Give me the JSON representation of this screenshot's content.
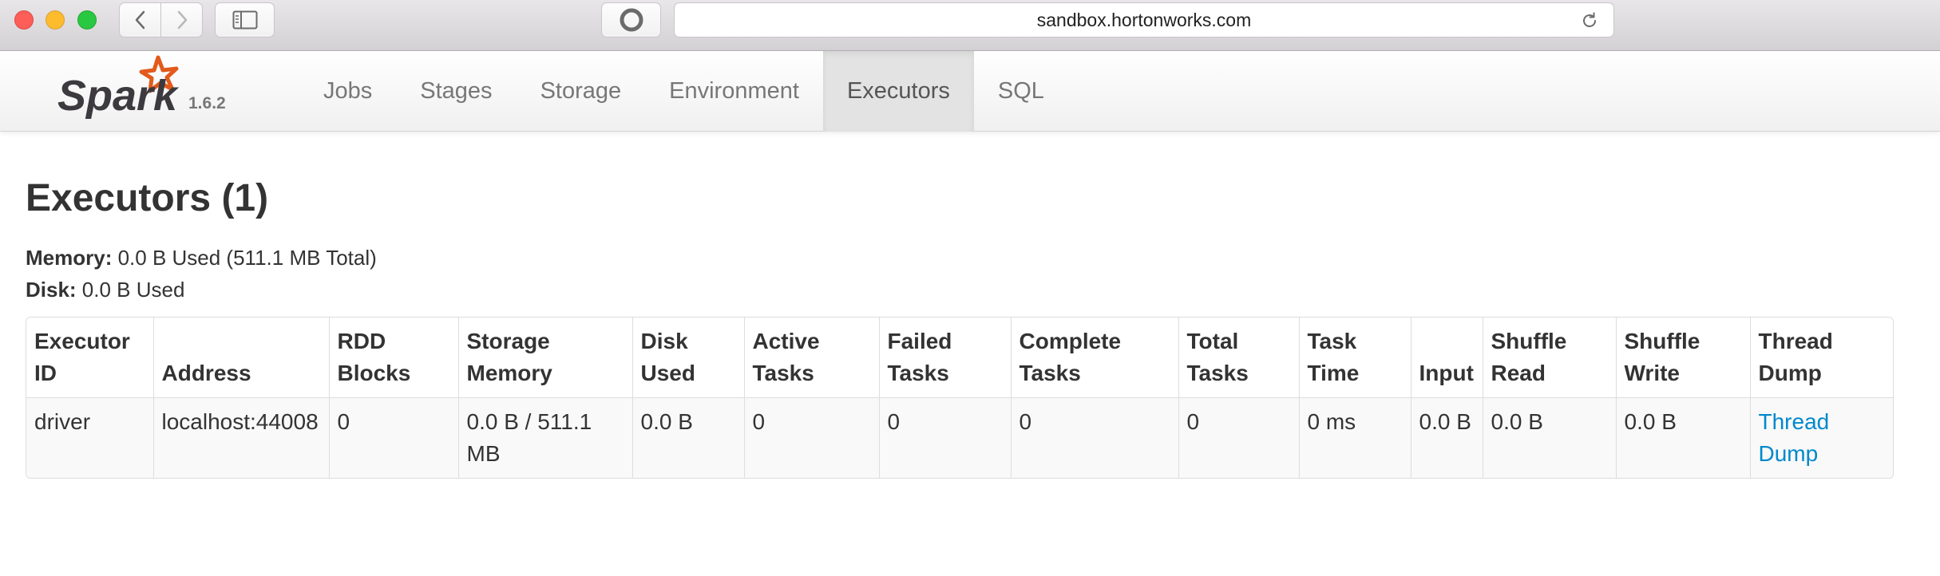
{
  "browser": {
    "url": "sandbox.hortonworks.com"
  },
  "navbar": {
    "brand": "Spark",
    "version": "1.6.2",
    "tabs": [
      {
        "label": "Jobs",
        "active": false
      },
      {
        "label": "Stages",
        "active": false
      },
      {
        "label": "Storage",
        "active": false
      },
      {
        "label": "Environment",
        "active": false
      },
      {
        "label": "Executors",
        "active": true
      },
      {
        "label": "SQL",
        "active": false
      }
    ]
  },
  "page": {
    "title": "Executors (1)",
    "memory_label": "Memory:",
    "memory_value": " 0.0 B Used (511.1 MB Total)",
    "disk_label": "Disk:",
    "disk_value": " 0.0 B Used"
  },
  "table": {
    "headers": [
      "Executor ID",
      "Address",
      "RDD Blocks",
      "Storage Memory",
      "Disk Used",
      "Active Tasks",
      "Failed Tasks",
      "Complete Tasks",
      "Total Tasks",
      "Task Time",
      "Input",
      "Shuffle Read",
      "Shuffle Write",
      "Thread Dump"
    ],
    "rows": [
      {
        "executor_id": "driver",
        "address": "localhost:44008",
        "rdd_blocks": "0",
        "storage_memory": "0.0 B / 511.1 MB",
        "disk_used": "0.0 B",
        "active_tasks": "0",
        "failed_tasks": "0",
        "complete_tasks": "0",
        "total_tasks": "0",
        "task_time": "0 ms",
        "input": "0.0 B",
        "shuffle_read": "0.0 B",
        "shuffle_write": "0.0 B",
        "thread_dump": "Thread Dump"
      }
    ]
  },
  "colors": {
    "link": "#0088cc",
    "spark_orange": "#e25a1c"
  },
  "icons": {
    "back": "chevron-left-icon",
    "forward": "chevron-right-icon",
    "sidebar": "sidebar-icon",
    "reader": "reader-icon",
    "reload": "reload-icon",
    "logo": "spark-logo"
  }
}
